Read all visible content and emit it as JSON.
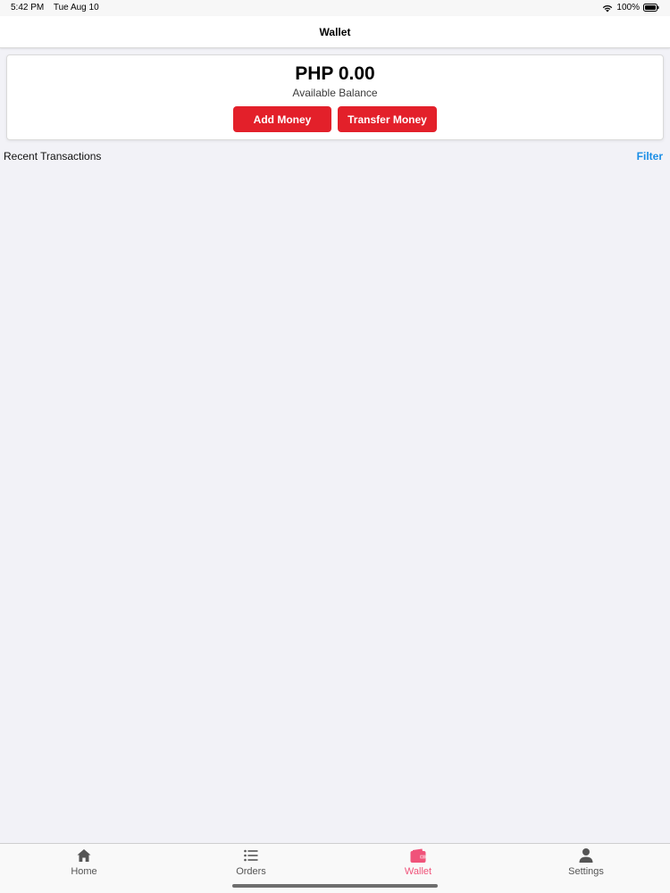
{
  "status_bar": {
    "time": "5:42 PM",
    "date": "Tue Aug 10",
    "battery": "100%",
    "icons": [
      "wifi-icon",
      "battery-icon"
    ]
  },
  "header": {
    "title": "Wallet"
  },
  "balance": {
    "amount": "PHP 0.00",
    "label": "Available Balance",
    "add_money_label": "Add Money",
    "transfer_money_label": "Transfer Money"
  },
  "transactions": {
    "title": "Recent Transactions",
    "filter_label": "Filter",
    "items": []
  },
  "tab_bar": {
    "tabs": [
      {
        "label": "Home",
        "icon": "home-icon",
        "active": false
      },
      {
        "label": "Orders",
        "icon": "list-icon",
        "active": false
      },
      {
        "label": "Wallet",
        "icon": "wallet-icon",
        "active": true
      },
      {
        "label": "Settings",
        "icon": "person-icon",
        "active": false
      }
    ]
  },
  "colors": {
    "accent_red": "#e3202a",
    "link_blue": "#1a8ee6",
    "active_tab": "#f0537a",
    "background": "#f2f2f7"
  }
}
